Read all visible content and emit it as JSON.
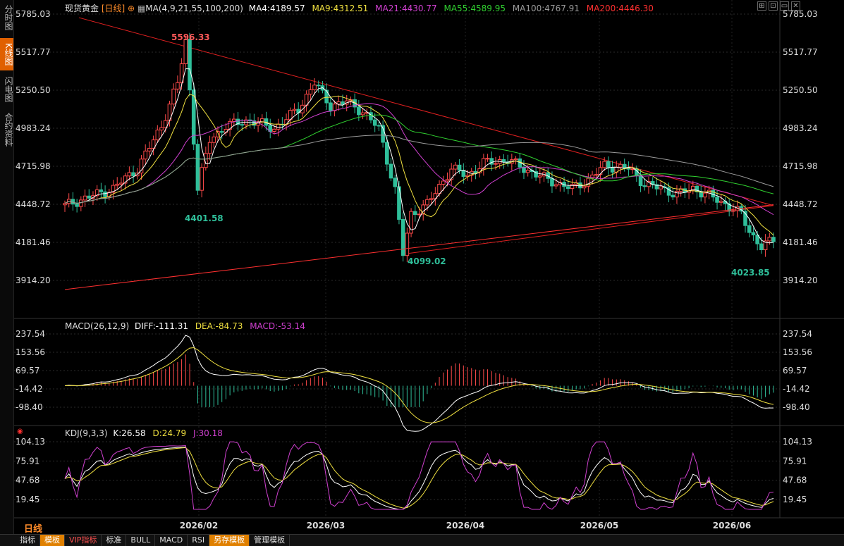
{
  "sidebar": {
    "tabs": [
      {
        "label": "分时图",
        "active": false
      },
      {
        "label": "K线图",
        "active": true
      },
      {
        "label": "闪电图",
        "active": false
      },
      {
        "label": "合约资料",
        "active": false
      }
    ]
  },
  "header": {
    "symbol": "现货黄金",
    "period": "[日线]",
    "ma_label": "MA(4,9,21,55,100,200)",
    "ma4": "MA4:4189.57",
    "ma9": "MA9:4312.51",
    "ma21": "MA21:4430.77",
    "ma55": "MA55:4589.95",
    "ma100": "MA100:4767.91",
    "ma200": "MA200:4446.30"
  },
  "macd_header": {
    "label": "MACD(26,12,9)",
    "diff": "DIFF:-111.31",
    "dea": "DEA:-84.73",
    "macd": "MACD:-53.14"
  },
  "kdj_header": {
    "label": "KDJ(9,3,3)",
    "k": "K:26.58",
    "d": "D:24.79",
    "j": "J:30.18"
  },
  "price_axis": [
    "5785.03",
    "5517.77",
    "5250.50",
    "4983.24",
    "4715.98",
    "4448.72",
    "4181.46",
    "3914.20"
  ],
  "macd_axis": [
    "237.54",
    "153.56",
    "69.57",
    "-14.42",
    "-98.40"
  ],
  "kdj_axis": [
    "104.13",
    "75.91",
    "47.68",
    "19.45"
  ],
  "x_axis": [
    "2026/02",
    "2026/03",
    "2026/04",
    "2026/05",
    "2026/06"
  ],
  "annotations": {
    "high": "5596.33",
    "low1": "4401.58",
    "low2": "4099.02",
    "low3": "4023.85"
  },
  "bottom_tabs": [
    {
      "label": "日线",
      "style": "title"
    },
    {
      "label": "指标",
      "style": "normal"
    },
    {
      "label": "模板",
      "style": "orange"
    },
    {
      "label": "VIP指标",
      "style": "red"
    },
    {
      "label": "标准",
      "style": "normal"
    },
    {
      "label": "BULL",
      "style": "normal"
    },
    {
      "label": "MACD",
      "style": "normal"
    },
    {
      "label": "RSI",
      "style": "normal"
    },
    {
      "label": "另存模板",
      "style": "orange"
    },
    {
      "label": "管理模板",
      "style": "normal"
    }
  ],
  "colors": {
    "up": "#ff4a4a",
    "down": "#2fbf9a",
    "ma4": "#ffffff",
    "ma9": "#f0e040",
    "ma21": "#d040d0",
    "ma55": "#30d030",
    "ma100": "#9a9a9a",
    "ma200": "#ff3030",
    "trendline": "#e02020"
  }
}
